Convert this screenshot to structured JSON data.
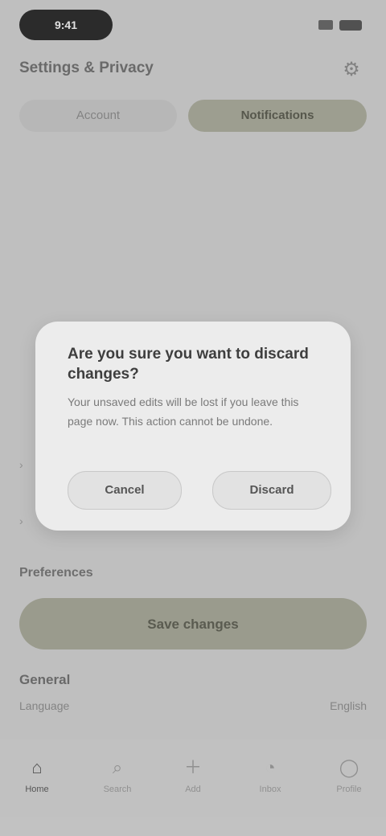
{
  "status_bar": {
    "time": "9:41",
    "signal_icon": "signal-icon",
    "battery_icon": "battery-icon"
  },
  "header": {
    "title": "Settings & Privacy",
    "icon": "gear-icon"
  },
  "tabs": [
    {
      "label": "Account"
    },
    {
      "label": "Notifications"
    }
  ],
  "section": {
    "label": "Preferences"
  },
  "primary_action": {
    "label": "Save changes"
  },
  "list": {
    "title": "General",
    "row_key": "Language",
    "row_value": "English"
  },
  "bottom_nav": [
    {
      "label": "Home",
      "icon": "home-icon"
    },
    {
      "label": "Search",
      "icon": "search-icon"
    },
    {
      "label": "Add",
      "icon": "plus-icon"
    },
    {
      "label": "Inbox",
      "icon": "bell-icon"
    },
    {
      "label": "Profile",
      "icon": "user-icon"
    }
  ],
  "dialog": {
    "title": "Are you sure you want to discard changes?",
    "body": "Your unsaved edits will be lost if you leave this page now. This action cannot be undone.",
    "cancel_label": "Cancel",
    "confirm_label": "Discard"
  },
  "colors": {
    "accent": "#a4a596",
    "background": "#cccccc",
    "dialog": "#ececec"
  }
}
